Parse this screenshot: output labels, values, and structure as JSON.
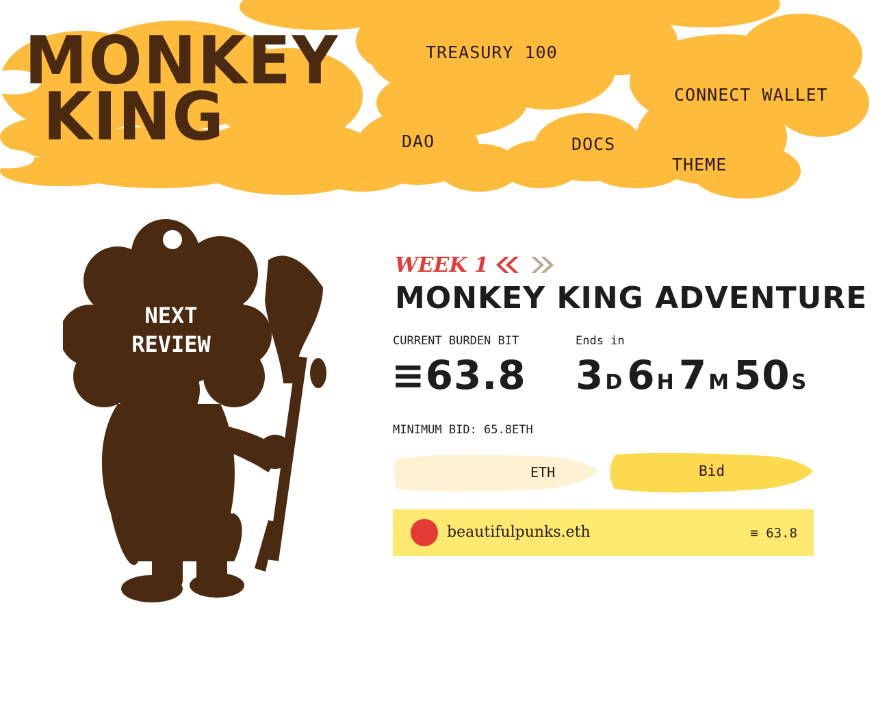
{
  "header": {
    "logo_line1": "MONKEY",
    "logo_line2": "KING",
    "nav": {
      "treasury": "TREASURY 100",
      "connect_wallet": "CONNECT WALLET",
      "dao": "DAO",
      "docs": "DOCS",
      "theme": "THEME"
    }
  },
  "hero": {
    "next_review_line1": "NEXT",
    "next_review_line2": "REVIEW"
  },
  "auction": {
    "week_label": "WEEK 1",
    "title": "MONKEY KING ADVENTURE",
    "current_bid_label": "CURRENT BURDEN BIT",
    "current_bid_value": "≡63.8",
    "ends_in_label": "Ends in",
    "countdown": {
      "days": "3",
      "days_unit": "D",
      "hours": "6",
      "hours_unit": "H",
      "minutes": "7",
      "minutes_unit": "M",
      "seconds": "50",
      "seconds_unit": "S"
    },
    "minimum_bid": "MINIMUM BID: 65.8ETH",
    "input_suffix": "ETH",
    "bid_button": "Bid"
  },
  "bids": [
    {
      "bidder": "beautifulpunks.eth",
      "amount": "≡ 63.8"
    }
  ],
  "colors": {
    "cloud": "#ffbb3c",
    "monkey": "#4b2a12",
    "accent_red": "#e53935",
    "input_bg": "#fff1d2",
    "button_bg": "#fcd94f",
    "bid_row_bg": "#fde96f"
  },
  "icons": {
    "prev": "chevron-double-left-icon",
    "next": "chevron-double-right-icon"
  }
}
